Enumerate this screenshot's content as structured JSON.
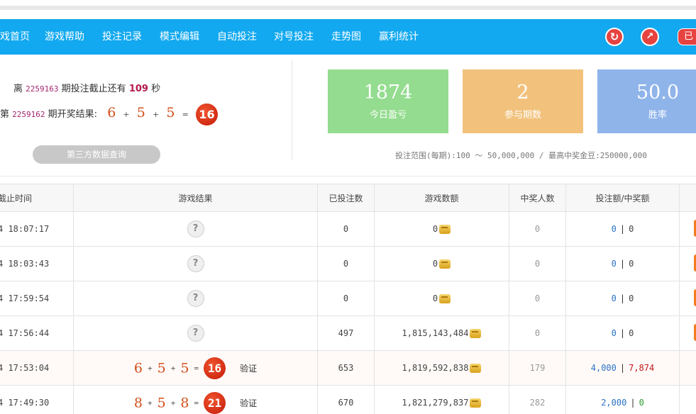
{
  "nav": {
    "items": [
      "戏首页",
      "游戏帮助",
      "投注记录",
      "模式编辑",
      "自动投注",
      "对号投注",
      "走势图",
      "赢利统计"
    ],
    "refresh_icon": "refresh-icon",
    "trend_icon": "trend-icon",
    "tag": "已"
  },
  "info": {
    "line1_prefix": "离",
    "line1_issue": "2259163",
    "line1_mid": "期投注截止还有",
    "line1_seconds": "109",
    "line1_suffix": "秒",
    "line2_prefix": "第",
    "line2_issue": "2259162",
    "line2_mid": "期开奖结果:",
    "draw": [
      "6",
      "5",
      "5"
    ],
    "plus": "+",
    "equals": "=",
    "sum": "16",
    "query_button": "第三方数据查询"
  },
  "stats": [
    {
      "value": "1874",
      "label": "今日盈亏",
      "color": "#94dc8f"
    },
    {
      "value": "2",
      "label": "参与期数",
      "color": "#f2c27d"
    },
    {
      "value": "50.0",
      "label": "胜率",
      "color": "#8fb4ea"
    }
  ],
  "range_text": "投注范围(每期):100 ～ 50,000,000 / 最高中奖金豆:250000,000",
  "table": {
    "headers": [
      "截止时间",
      "游戏结果",
      "已投注数",
      "游戏数额",
      "中奖人数",
      "投注额/中奖额",
      ""
    ],
    "rows": [
      {
        "time": "4 18:07:17",
        "result": null,
        "question": "?",
        "bets": "0",
        "amount": "0",
        "winners": "0",
        "bet_amt": "0",
        "win_amt": "0"
      },
      {
        "time": "4 18:03:43",
        "result": null,
        "question": "?",
        "bets": "0",
        "amount": "0",
        "winners": "0",
        "bet_amt": "0",
        "win_amt": "0"
      },
      {
        "time": "4 17:59:54",
        "result": null,
        "question": "?",
        "bets": "0",
        "amount": "0",
        "winners": "0",
        "bet_amt": "0",
        "win_amt": "0"
      },
      {
        "time": "4 17:56:44",
        "result": null,
        "question": "?",
        "bets": "497",
        "amount": "1,815,143,484",
        "winners": "0",
        "bet_amt": "0",
        "win_amt": "0"
      },
      {
        "time": "4 17:53:04",
        "result": {
          "nums": [
            "6",
            "5",
            "5"
          ],
          "sum": "16"
        },
        "verify": "验证",
        "bets": "653",
        "amount": "1,819,592,838",
        "winners": "179",
        "bet_amt": "4,000",
        "win_amt": "7,874"
      },
      {
        "time": "4 17:49:30",
        "result": {
          "nums": [
            "8",
            "5",
            "8"
          ],
          "sum": "21"
        },
        "verify": "验证",
        "bets": "670",
        "amount": "1,821,279,837",
        "winners": "282",
        "bet_amt": "2,000",
        "win_amt": "0"
      }
    ],
    "separator": "|"
  }
}
